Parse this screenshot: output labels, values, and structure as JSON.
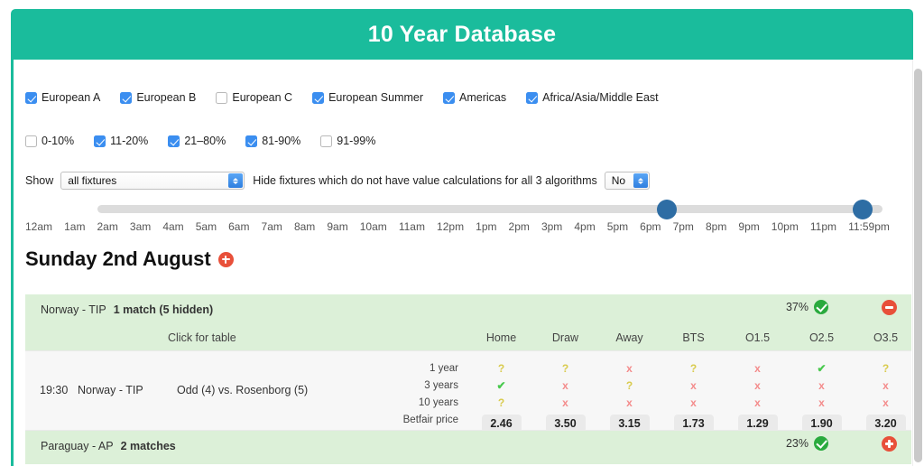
{
  "header": {
    "title": "10 Year Database",
    "accent_color": "#1abc9c"
  },
  "filters": {
    "leagues": [
      {
        "label": "European A",
        "checked": true
      },
      {
        "label": "European B",
        "checked": true
      },
      {
        "label": "European C",
        "checked": false
      },
      {
        "label": "European Summer",
        "checked": true
      },
      {
        "label": "Americas",
        "checked": true
      },
      {
        "label": "Africa/Asia/Middle East",
        "checked": true
      }
    ],
    "percent_bands": [
      {
        "label": "0-10%",
        "checked": false
      },
      {
        "label": "11-20%",
        "checked": true
      },
      {
        "label": "21–80%",
        "checked": true
      },
      {
        "label": "81-90%",
        "checked": true
      },
      {
        "label": "91-99%",
        "checked": false
      }
    ],
    "show_label": "Show",
    "show_value": "all fixtures",
    "hide_text": "Hide fixtures which do not have value calculations for all 3 algorithms",
    "hide_value": "No"
  },
  "slider": {
    "hours": [
      "12am",
      "1am",
      "2am",
      "3am",
      "4am",
      "5am",
      "6am",
      "7am",
      "8am",
      "9am",
      "10am",
      "11am",
      "12pm",
      "1pm",
      "2pm",
      "3pm",
      "4pm",
      "5pm",
      "6pm",
      "7pm",
      "8pm",
      "9pm",
      "10pm",
      "11pm",
      "11:59pm"
    ],
    "handle_low": "6pm",
    "handle_high": "11:59pm",
    "handle_color": "#2e6da4"
  },
  "date_heading": "Sunday 2nd August",
  "columns": [
    "Home",
    "Draw",
    "Away",
    "BTS",
    "O1.5",
    "O2.5",
    "O3.5"
  ],
  "click_for_table": "Click for table",
  "groups": {
    "norway": {
      "name": "Norway - TIP",
      "count": "1 match (5 hidden)",
      "percent": "37%",
      "toggle": "minus"
    },
    "paraguay": {
      "name": "Paraguay - AP",
      "count": "2 matches",
      "percent": "23%",
      "toggle": "plus"
    }
  },
  "fixture": {
    "time": "19:30",
    "league": "Norway - TIP",
    "teams": "Odd (4) vs. Rosenborg (5)",
    "row_labels": [
      "1 year",
      "3 years",
      "10 years",
      "Betfair price"
    ],
    "rows": [
      {
        "label": "1 year",
        "values": [
          "?",
          "?",
          "x",
          "?",
          "x",
          "check",
          "?"
        ]
      },
      {
        "label": "3 years",
        "values": [
          "check",
          "x",
          "?",
          "x",
          "x",
          "x",
          "x"
        ]
      },
      {
        "label": "10 years",
        "values": [
          "?",
          "x",
          "x",
          "x",
          "x",
          "x",
          "x"
        ]
      }
    ],
    "betfair_prices": [
      "2.46",
      "3.50",
      "3.15",
      "1.73",
      "1.29",
      "1.90",
      "3.20"
    ]
  }
}
